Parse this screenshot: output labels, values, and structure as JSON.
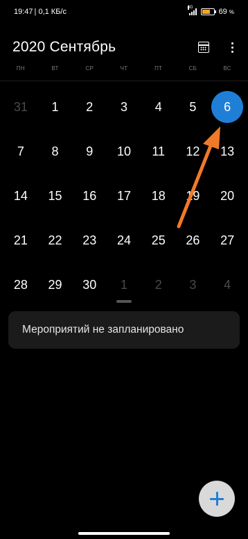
{
  "status_bar": {
    "time": "19:47",
    "speed": "| 0,1 КБ/с",
    "network": "4G",
    "battery": "69",
    "battery_unit": "%",
    "battery_level": 0.69
  },
  "header": {
    "title": "2020 Сентябрь",
    "calendar_icon": "calendar-icon",
    "more_icon": "more-vertical-icon"
  },
  "weekdays": [
    "ПН",
    "ВТ",
    "СР",
    "ЧТ",
    "ПТ",
    "СБ",
    "ВС"
  ],
  "days": [
    {
      "label": "31",
      "muted": true
    },
    {
      "label": "1"
    },
    {
      "label": "2"
    },
    {
      "label": "3"
    },
    {
      "label": "4"
    },
    {
      "label": "5"
    },
    {
      "label": "6",
      "today": true
    },
    {
      "label": "7"
    },
    {
      "label": "8"
    },
    {
      "label": "9"
    },
    {
      "label": "10"
    },
    {
      "label": "11"
    },
    {
      "label": "12"
    },
    {
      "label": "13"
    },
    {
      "label": "14"
    },
    {
      "label": "15"
    },
    {
      "label": "16"
    },
    {
      "label": "17"
    },
    {
      "label": "18"
    },
    {
      "label": "19"
    },
    {
      "label": "20"
    },
    {
      "label": "21"
    },
    {
      "label": "22"
    },
    {
      "label": "23"
    },
    {
      "label": "24"
    },
    {
      "label": "25"
    },
    {
      "label": "26"
    },
    {
      "label": "27"
    },
    {
      "label": "28"
    },
    {
      "label": "29"
    },
    {
      "label": "30"
    },
    {
      "label": "1",
      "muted": true
    },
    {
      "label": "2",
      "muted": true
    },
    {
      "label": "3",
      "muted": true
    },
    {
      "label": "4",
      "muted": true
    }
  ],
  "events": {
    "empty_text": "Мероприятий не запланировано"
  },
  "fab": {
    "icon": "plus-icon"
  },
  "colors": {
    "accent": "#1f7fd6",
    "annotation_arrow": "#f07a2a",
    "background": "#000000"
  }
}
